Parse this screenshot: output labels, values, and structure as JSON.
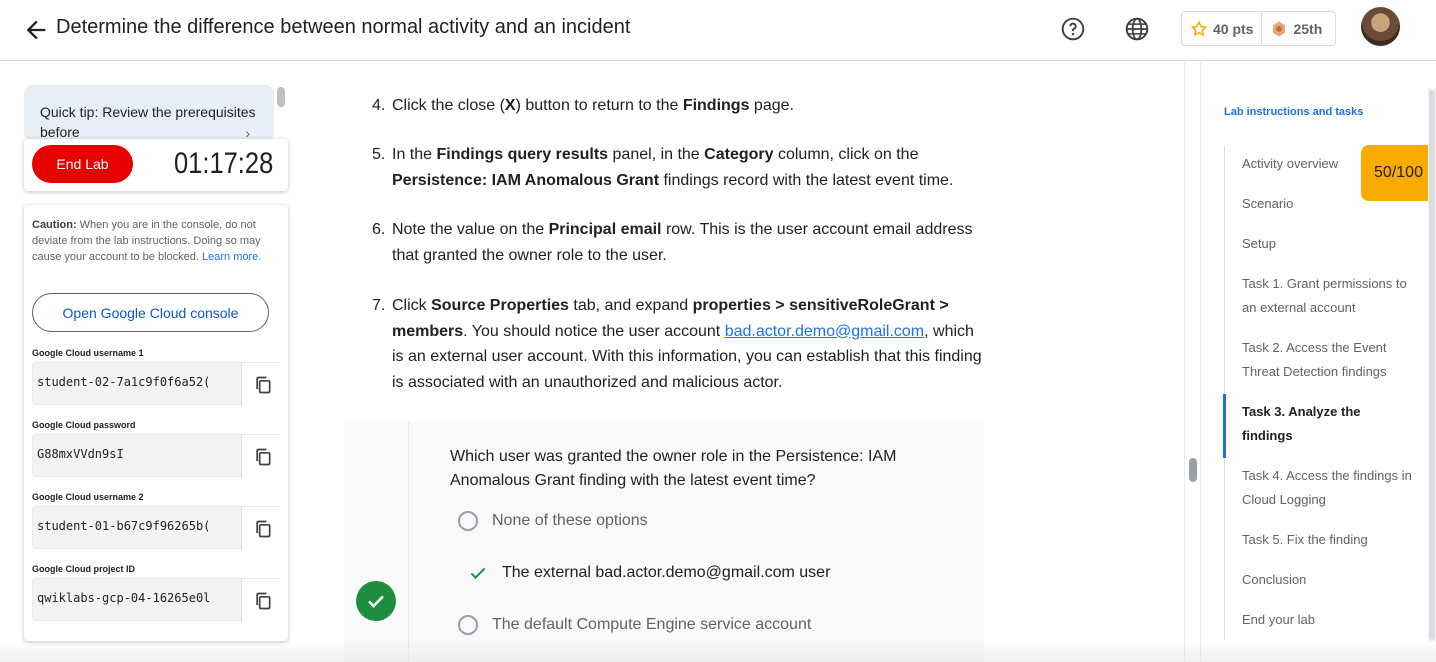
{
  "header": {
    "title": "Determine the difference between normal activity and an incident",
    "points": "40 pts",
    "rank": "25th"
  },
  "left_panel": {
    "tip_text": "Quick tip: Review the prerequisites before",
    "end_lab_label": "End Lab",
    "timer": "01:17:28",
    "caution_bold": "Caution:",
    "caution_text": " When you are in the console, do not deviate from the lab instructions. Doing so may cause your account to be blocked.",
    "learn_more": "Learn more.",
    "console_button": "Open Google Cloud console",
    "fields": [
      {
        "label": "Google Cloud username 1",
        "value": "student-02-7a1c9f0f6a52("
      },
      {
        "label": "Google Cloud password",
        "value": "G88mxVVdn9sI"
      },
      {
        "label": "Google Cloud username 2",
        "value": "student-01-b67c9f96265b("
      },
      {
        "label": "Google Cloud project ID",
        "value": "qwiklabs-gcp-04-16265e0l"
      }
    ]
  },
  "main": {
    "steps": [
      {
        "num": "4.",
        "parts": [
          "Click the close (",
          "X",
          ") button to return to the ",
          "Findings",
          " page."
        ]
      },
      {
        "num": "5.",
        "parts": [
          "In the ",
          "Findings query results",
          " panel, in the ",
          "Category",
          " column, click on the ",
          "Persistence: IAM Anomalous Grant",
          " findings record with the latest event time."
        ]
      },
      {
        "num": "6.",
        "parts": [
          "Note the value on the ",
          "Principal email",
          " row. This is the user account email address that granted the owner role to the user."
        ]
      },
      {
        "num": "7.",
        "parts": [
          "Click ",
          "Source Properties",
          " tab, and expand ",
          "properties > sensitiveRoleGrant > members",
          ". You should notice the user account ",
          "bad.actor.demo@gmail.com",
          ", which is an external user account. With this information, you can establish that this finding is associated with an unauthorized and malicious actor."
        ]
      }
    ],
    "question": "Which user was granted the owner role in the Persistence: IAM Anomalous Grant finding with the latest event time?",
    "options": [
      "None of these options",
      "The external bad.actor.demo@gmail.com user",
      "The default Compute Engine service account"
    ]
  },
  "right_nav": {
    "title": "Lab instructions and tasks",
    "score": "50/100",
    "items": [
      "Activity overview",
      "Scenario",
      "Setup",
      "Task 1. Grant permissions to an external account",
      "Task 2. Access the Event Threat Detection findings",
      "Task 3. Analyze the findings",
      "Task 4. Access the findings in Cloud Logging",
      "Task 5. Fix the finding",
      "Conclusion",
      "End your lab"
    ]
  }
}
